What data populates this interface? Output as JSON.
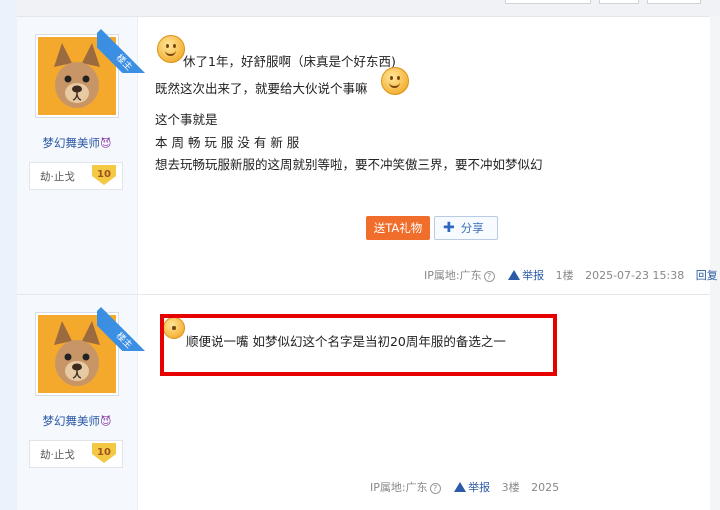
{
  "posts": [
    {
      "author": {
        "name": "梦幻舞美师",
        "name_emoji": "😈",
        "title": "劫·止戈",
        "level": "10",
        "badge": "楼主"
      },
      "lines": [
        "休了1年，好舒服啊（床真是个好东西)",
        "既然这次出来了，就要给大伙说个事嘛",
        "这个事就是",
        "本 周 畅 玩 服 没 有 新 服",
        "想去玩畅玩服新服的这周就别等啦，要不冲笑傲三界，要不冲如梦似幻"
      ],
      "gift_label": "送TA礼物",
      "share_label": "分享",
      "meta": {
        "ip": "IP属地:广东",
        "report": "举报",
        "floor": "1楼",
        "time": "2025-07-23 15:38",
        "reply": "回复"
      }
    },
    {
      "author": {
        "name": "梦幻舞美师",
        "name_emoji": "😈",
        "title": "劫·止戈",
        "level": "10",
        "badge": "楼主"
      },
      "lines": [
        "顺便说一嘴 如梦似幻这个名字是当初20周年服的备选之一"
      ],
      "meta": {
        "ip": "IP属地:广东",
        "report": "举报",
        "floor": "3楼",
        "time": "2025"
      }
    }
  ],
  "colors": {
    "accent_blue": "#3b8fe3",
    "gift_orange": "#f06d2b",
    "highlight_red": "#e60000"
  },
  "icons": {
    "question": "question-circle-icon",
    "warning": "warning-icon",
    "smiley": "smiley-icon",
    "plus": "plus-icon"
  }
}
